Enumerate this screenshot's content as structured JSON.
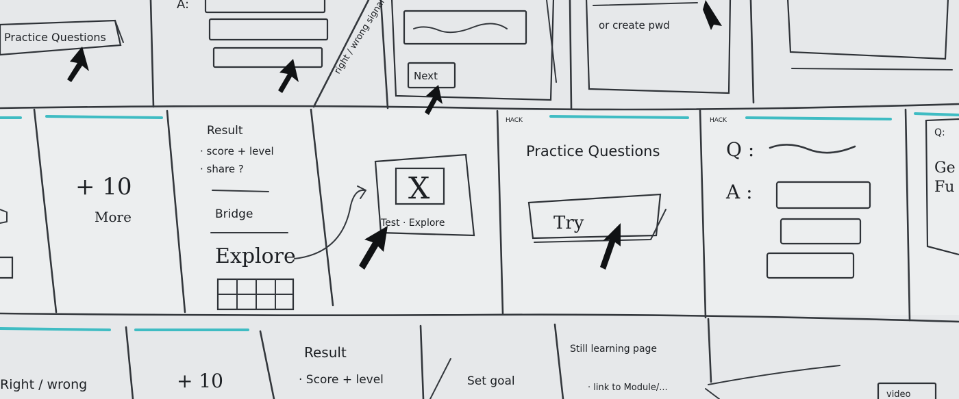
{
  "title": "",
  "top_row": {
    "frame_a": {
      "button_label": "Practice Questions"
    },
    "frame_b": {
      "prefix_label": "A:"
    },
    "frame_c": {
      "side_note": "right / wrong signal"
    },
    "frame_d": {
      "next_label": "Next"
    },
    "frame_e": {
      "note_label": "or create pwd"
    }
  },
  "middle_row": {
    "frame_plus": {
      "points": "+ 10",
      "unit": "More"
    },
    "frame_result": {
      "heading": "Result",
      "bullets": [
        "· score + level",
        "· share ?"
      ],
      "bridge": "Bridge",
      "explore": "Explore"
    },
    "frame_test": {
      "icon_glyph": "X",
      "caption": "Test · Explore"
    },
    "frame_practice": {
      "tag": "HACK",
      "heading": "Practice Questions",
      "button_label": "Try"
    },
    "frame_qa": {
      "tag": "HACK",
      "question_label": "Q :",
      "answer_label": "A :"
    },
    "frame_edge": {
      "label_a": "Q:",
      "label_b": "Ge",
      "label_c": "Fu"
    }
  },
  "bottom_row": {
    "frame_rw": {
      "label": "Right / wrong"
    },
    "frame_plus": {
      "label": "+ 10"
    },
    "frame_result": {
      "heading": "Result",
      "bullet": "· Score + level"
    },
    "frame_goal": {
      "label": "Set goal"
    },
    "frame_learning": {
      "heading": "Still learning page",
      "bullet": "· link to Module/..."
    },
    "frame_video": {
      "label": "video"
    }
  },
  "colors": {
    "board": "#e9ebec",
    "ink": "#1c1f23",
    "accent_teal": "#3fbcc3"
  }
}
